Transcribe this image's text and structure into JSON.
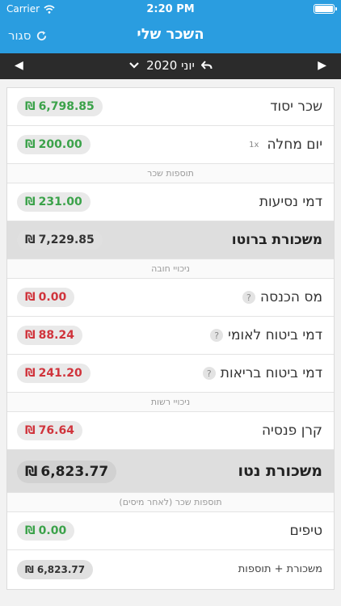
{
  "status_bar": {
    "carrier": "Carrier",
    "time": "2:20 PM"
  },
  "header": {
    "title": "השכר שלי",
    "close_label": "סגור"
  },
  "month_bar": {
    "month": "יוני 2020"
  },
  "currency": "₪",
  "rows": {
    "base_salary": {
      "label": "שכר יסוד",
      "amount": "6,798.85"
    },
    "sick_day": {
      "label": "יום מחלה",
      "multiplier": "1x",
      "amount": "200.00"
    },
    "section_additions": "תוספות שכר",
    "travel": {
      "label": "דמי נסיעות",
      "amount": "231.00"
    },
    "gross": {
      "label": "משכורת ברוטו",
      "amount": "7,229.85"
    },
    "section_mandatory": "ניכויי חובה",
    "income_tax": {
      "label": "מס הכנסה",
      "amount": "0.00"
    },
    "national_insurance": {
      "label": "דמי ביטוח לאומי",
      "amount": "88.24"
    },
    "health_insurance": {
      "label": "דמי ביטוח בריאות",
      "amount": "241.20"
    },
    "section_optional": "ניכויי רשות",
    "pension": {
      "label": "קרן פנסיה",
      "amount": "76.64"
    },
    "net": {
      "label": "משכורת נטו",
      "amount": "6,823.77"
    },
    "section_after_tax": "תוספות שכר (לאחר מיסים)",
    "tips": {
      "label": "טיפים",
      "amount": "0.00"
    },
    "net_plus": {
      "label": "משכורת + תוספות",
      "amount": "6,823.77"
    }
  },
  "colors": {
    "header": "#2a9de0",
    "positive": "#3ba24a",
    "negative": "#d0343c"
  }
}
